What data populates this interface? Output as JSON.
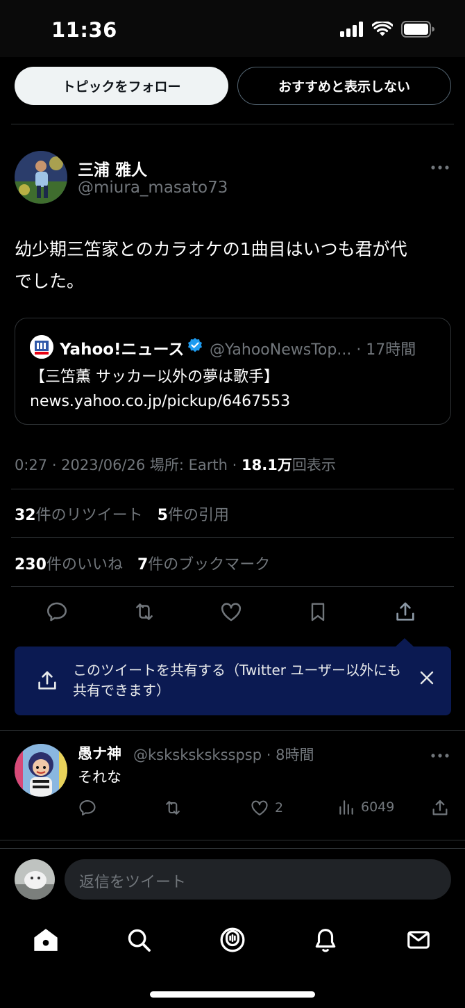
{
  "status_bar": {
    "time": "11:36"
  },
  "topic": {
    "follow_label": "トピックをフォロー",
    "hide_label": "おすすめと表示しない"
  },
  "tweet": {
    "author_name": "三浦 雅人",
    "author_handle": "@miura_masato73",
    "text_line1": "幼少期三笘家とのカラオケの1曲目はいつも君が代",
    "text_line2": "でした。",
    "quote": {
      "name": "Yahoo!ニュース",
      "handle": "@YahooNewsTop...",
      "time": "· 17時間",
      "text_line1": "【三笘薫 サッカー以外の夢は歌手】",
      "text_line2": "news.yahoo.co.jp/pickup/6467553"
    },
    "timestamp": "0:27 · 2023/06/26 場所: Earth · ",
    "views": "18.1万",
    "views_label": "回表示",
    "retweets": "32",
    "retweets_label": "件のリツイート",
    "quotes": "5",
    "quotes_label": "件の引用",
    "likes": "230",
    "likes_label": "件のいいね",
    "bookmarks": "7",
    "bookmarks_label": "件のブックマーク"
  },
  "share_tip": {
    "text": "このツイートを共有する（Twitter ユーザー以外にも共有できます）"
  },
  "reply": {
    "author_name": "愚ナ神",
    "meta": "@ksksksksksspsp · 8時間",
    "text": "それな",
    "likes": "2",
    "views": "6049"
  },
  "reply_input": {
    "placeholder": "返信をツイート"
  },
  "colors": {
    "accent": "#1d9bf0",
    "banner": "#0b1a52",
    "background": "#000000"
  }
}
